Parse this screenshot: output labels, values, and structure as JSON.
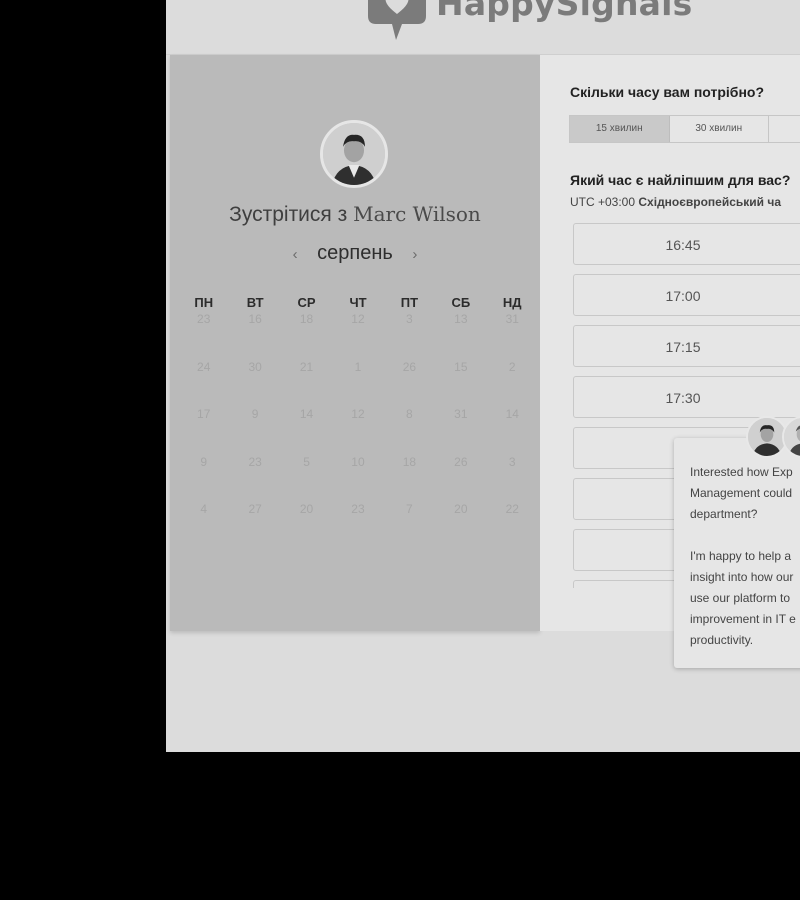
{
  "brand": {
    "name": "HappySignals"
  },
  "calendar": {
    "title_prefix": "Зустрітися з",
    "host_name": "Marc Wilson",
    "month": "серпень",
    "prev_arrow": "‹",
    "next_arrow": "›",
    "weekdays": [
      "ПН",
      "ВТ",
      "СР",
      "ЧТ",
      "ПТ",
      "СБ",
      "НД"
    ],
    "weeks": [
      [
        "23",
        "16",
        "18",
        "12",
        "3",
        "13",
        "31"
      ],
      [
        "24",
        "30",
        "21",
        "1",
        "26",
        "15",
        "2"
      ],
      [
        "17",
        "9",
        "14",
        "12",
        "8",
        "31",
        "14"
      ],
      [
        "9",
        "23",
        "5",
        "10",
        "18",
        "26",
        "3"
      ],
      [
        "4",
        "27",
        "20",
        "23",
        "7",
        "20",
        "22"
      ]
    ]
  },
  "scheduler": {
    "duration_question": "Скільки часу вам потрібно?",
    "durations": [
      "15 хвилин",
      "30 хвилин",
      ""
    ],
    "time_question": "Який час є найліпшим для вас?",
    "timezone_offset": "UTC +03:00",
    "timezone_name": "Східноєвропейський ча",
    "slots": [
      "16:45",
      "17:00",
      "17:15",
      "17:30",
      "",
      "",
      "",
      ""
    ]
  },
  "chat": {
    "message": "Interested how Exp\nManagement could\ndepartment?\n\nI'm happy to help a\ninsight into how our\nuse our platform to\nimprovement in IT e\nproductivity."
  }
}
